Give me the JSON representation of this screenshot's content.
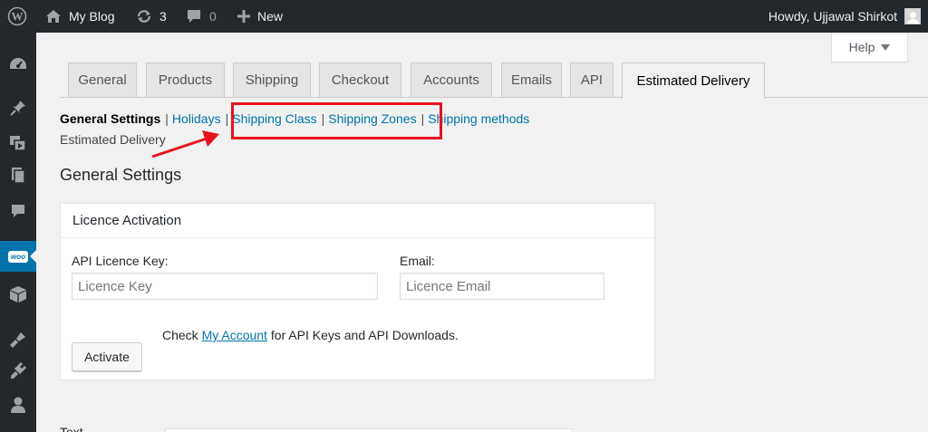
{
  "adminbar": {
    "site_name": "My Blog",
    "updates_count": "3",
    "comments_count": "0",
    "new_label": "New",
    "howdy": "Howdy, Ujjawal Shirkot"
  },
  "help": {
    "label": "Help"
  },
  "sidemenu": {
    "items": [
      "dashboard-icon",
      "pin-icon",
      "media-icon",
      "pages-icon",
      "comments-icon",
      "woocommerce-icon",
      "products-icon",
      "appearance-icon",
      "plugins-icon",
      "users-icon"
    ],
    "woo_badge": "woo",
    "active_color": "#0073aa"
  },
  "tabs": [
    "General",
    "Products",
    "Shipping",
    "Checkout",
    "Accounts",
    "Emails",
    "API",
    "Estimated Delivery"
  ],
  "active_tab": "Estimated Delivery",
  "subnav": {
    "current": "General Settings",
    "links": [
      "Holidays",
      "Shipping Class",
      "Shipping Zones",
      "Shipping methods"
    ],
    "second_line": "Estimated Delivery",
    "highlight_color": "#e8131f"
  },
  "page_title": "General Settings",
  "panel": {
    "title": "Licence Activation",
    "api_key_label": "API Licence Key:",
    "api_key_placeholder": "Licence Key",
    "email_label": "Email:",
    "email_placeholder": "Licence Email",
    "note_prefix": "Check",
    "note_link": "My Account",
    "note_suffix": "for API Keys and API Downloads.",
    "activate_label": "Activate"
  },
  "bottom_label": "Text"
}
